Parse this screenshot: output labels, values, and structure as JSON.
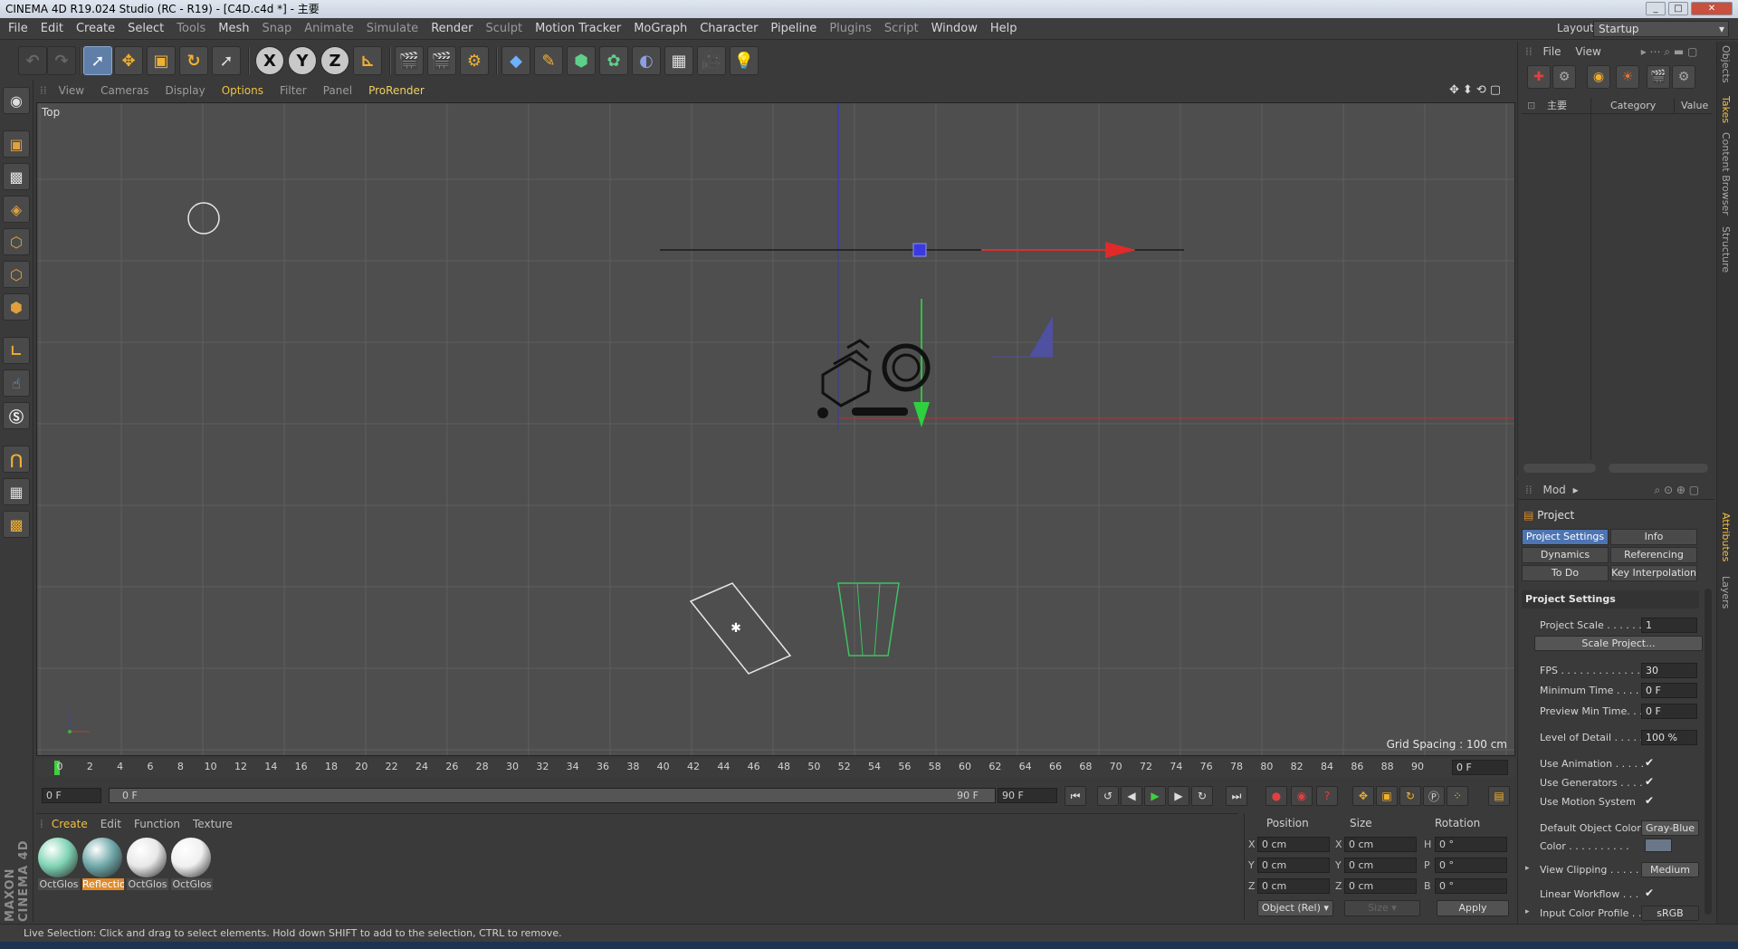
{
  "window": {
    "title": "CINEMA 4D R19.024 Studio (RC - R19) - [C4D.c4d *] - 主要",
    "controls": [
      "_",
      "□",
      "✕"
    ]
  },
  "menubar": {
    "items": [
      "File",
      "Edit",
      "Create",
      "Select",
      "Tools",
      "Mesh",
      "Snap",
      "Animate",
      "Simulate",
      "Render",
      "Sculpt",
      "Motion Tracker",
      "MoGraph",
      "Character",
      "Pipeline",
      "Plugins",
      "Script",
      "Window",
      "Help"
    ],
    "dim_items": [
      "Tools",
      "Snap",
      "Animate",
      "Simulate",
      "Sculpt",
      "Plugins",
      "Script"
    ],
    "layout_label": "Layout:",
    "layout_value": "Startup"
  },
  "toolbar": {
    "axis_x": "X",
    "axis_y": "Y",
    "axis_z": "Z"
  },
  "viewport": {
    "menu": [
      "View",
      "Cameras",
      "Display",
      "Options",
      "Filter",
      "Panel",
      "ProRender"
    ],
    "highlighted": [
      "Options",
      "ProRender"
    ],
    "name": "Top",
    "grid_spacing": "Grid Spacing : 100 cm"
  },
  "timeline": {
    "ticks": [
      0,
      2,
      4,
      6,
      8,
      10,
      12,
      14,
      16,
      18,
      20,
      22,
      24,
      26,
      28,
      30,
      32,
      34,
      36,
      38,
      40,
      42,
      44,
      46,
      48,
      50,
      52,
      54,
      56,
      58,
      60,
      62,
      64,
      66,
      68,
      70,
      72,
      74,
      76,
      78,
      80,
      82,
      84,
      86,
      88,
      90
    ],
    "current_frame": "0 F",
    "start": "0 F",
    "range_start": "0 F",
    "range_end": "90 F",
    "end": "90 F"
  },
  "material_manager": {
    "menu": [
      "Create",
      "Edit",
      "Function",
      "Texture"
    ],
    "materials": [
      {
        "label": "OctGlos",
        "color": "#7fd3b4",
        "selected": false
      },
      {
        "label": "Reflectio",
        "color": "#6fa7a8",
        "selected": true
      },
      {
        "label": "OctGlos",
        "color": "#e8e8e8",
        "selected": false
      },
      {
        "label": "OctGlos",
        "color": "#f0f0f0",
        "selected": false
      }
    ]
  },
  "coordinates": {
    "headers": {
      "position": "Position",
      "size": "Size",
      "rotation": "Rotation"
    },
    "rows": [
      {
        "axis": "X",
        "pos": "0 cm",
        "size_axis": "X",
        "size": "0 cm",
        "rot_axis": "H",
        "rot": "0 °"
      },
      {
        "axis": "Y",
        "pos": "0 cm",
        "size_axis": "Y",
        "size": "0 cm",
        "rot_axis": "P",
        "rot": "0 °"
      },
      {
        "axis": "Z",
        "pos": "0 cm",
        "size_axis": "Z",
        "size": "0 cm",
        "rot_axis": "B",
        "rot": "0 °"
      }
    ],
    "mode": "Object (Rel)",
    "size_mode": "Size",
    "apply": "Apply"
  },
  "objects_panel": {
    "menu": [
      "File",
      "View"
    ],
    "col_name": "主要",
    "col_category": "Category",
    "col_value": "Value"
  },
  "attributes": {
    "mode": "Mod",
    "object": "Project",
    "tabs": [
      {
        "label": "Project Settings",
        "selected": true
      },
      {
        "label": "Info",
        "selected": false
      },
      {
        "label": "Dynamics",
        "selected": false
      },
      {
        "label": "Referencing",
        "selected": false
      },
      {
        "label": "To Do",
        "selected": false
      },
      {
        "label": "Key Interpolation",
        "selected": false
      }
    ],
    "section": "Project Settings",
    "project_scale_label": "Project Scale . . . . . .",
    "project_scale": "1",
    "scale_project_button": "Scale Project...",
    "fps_label": "FPS . . . . . . . . . . . . . .",
    "fps": "30",
    "min_time_label": "Minimum Time . . . . .",
    "min_time": "0 F",
    "preview_min_label": "Preview Min Time. . .",
    "preview_min": "0 F",
    "lod_label": "Level of Detail . . . . .",
    "lod": "100 %",
    "use_animation": "Use Animation . . . . .",
    "use_generators": "Use Generators . . . .",
    "use_motion": "Use Motion System",
    "default_color_label": "Default Object Color",
    "default_color": "Gray-Blue",
    "color_label": "Color . . . . . . . . . .",
    "view_clipping_label": "View Clipping . . . . .",
    "view_clipping": "Medium",
    "linear_workflow": "Linear Workflow . . .",
    "input_profile_label": "Input Color Profile . .",
    "input_profile": "sRGB",
    "check": "✔"
  },
  "side_tabs": [
    "Objects",
    "Takes",
    "Content Browser",
    "Structure",
    "Attributes",
    "Layers"
  ],
  "side_tabs_highlighted": [
    "Takes",
    "Attributes"
  ],
  "brand": "MAXON CINEMA 4D",
  "status": "Live Selection: Click and drag to select elements. Hold down SHIFT to add to the selection, CTRL to remove."
}
